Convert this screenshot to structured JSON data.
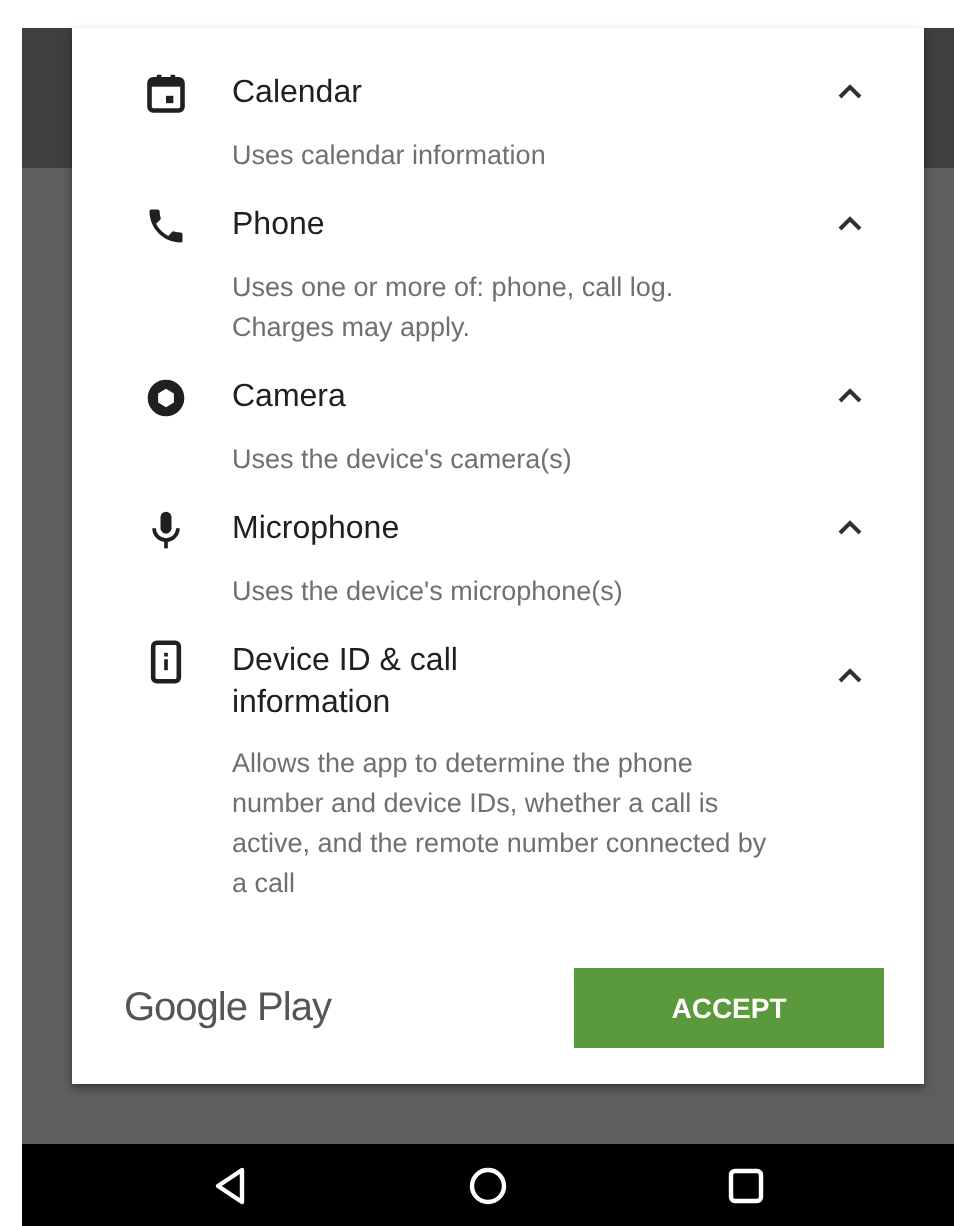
{
  "permissions": [
    {
      "kind": "calendar",
      "title": "Calendar",
      "description": "Uses calendar information",
      "expanded": true
    },
    {
      "kind": "phone",
      "title": "Phone",
      "description": "Uses one or more of: phone, call log. Charges may apply.",
      "expanded": true
    },
    {
      "kind": "camera",
      "title": "Camera",
      "description": "Uses the device's camera(s)",
      "expanded": true
    },
    {
      "kind": "microphone",
      "title": "Microphone",
      "description": "Uses the device's microphone(s)",
      "expanded": true
    },
    {
      "kind": "device",
      "title": "Device ID & call information",
      "description": "Allows the app to determine the phone number and device IDs, whether a call is active, and the remote number connected by a call",
      "expanded": true
    }
  ],
  "footer": {
    "brand": "Google Play",
    "button": "ACCEPT"
  }
}
